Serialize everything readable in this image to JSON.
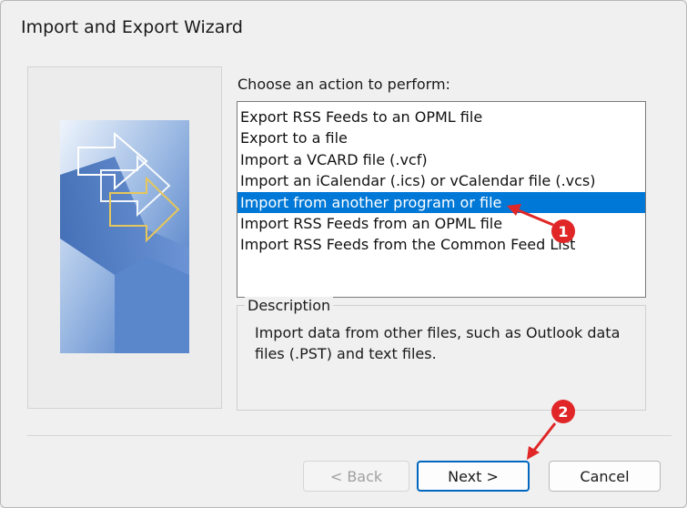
{
  "window": {
    "title": "Import and Export Wizard"
  },
  "prompt": "Choose an action to perform:",
  "actions": [
    {
      "label": "Export RSS Feeds to an OPML file",
      "selected": false
    },
    {
      "label": "Export to a file",
      "selected": false
    },
    {
      "label": "Import a VCARD file (.vcf)",
      "selected": false
    },
    {
      "label": "Import an iCalendar (.ics) or vCalendar file (.vcs)",
      "selected": false
    },
    {
      "label": "Import from another program or file",
      "selected": true
    },
    {
      "label": "Import RSS Feeds from an OPML file",
      "selected": false
    },
    {
      "label": "Import RSS Feeds from the Common Feed List",
      "selected": false
    }
  ],
  "description": {
    "legend": "Description",
    "text": "Import data from other files, such as Outlook data files (.PST) and text files."
  },
  "buttons": {
    "back": "< Back",
    "next": "Next >",
    "cancel": "Cancel"
  },
  "annotations": {
    "marker1": "1",
    "marker2": "2",
    "color": "#e02626"
  },
  "colors": {
    "selection": "#0078d7",
    "accent_border": "#0067c0"
  }
}
